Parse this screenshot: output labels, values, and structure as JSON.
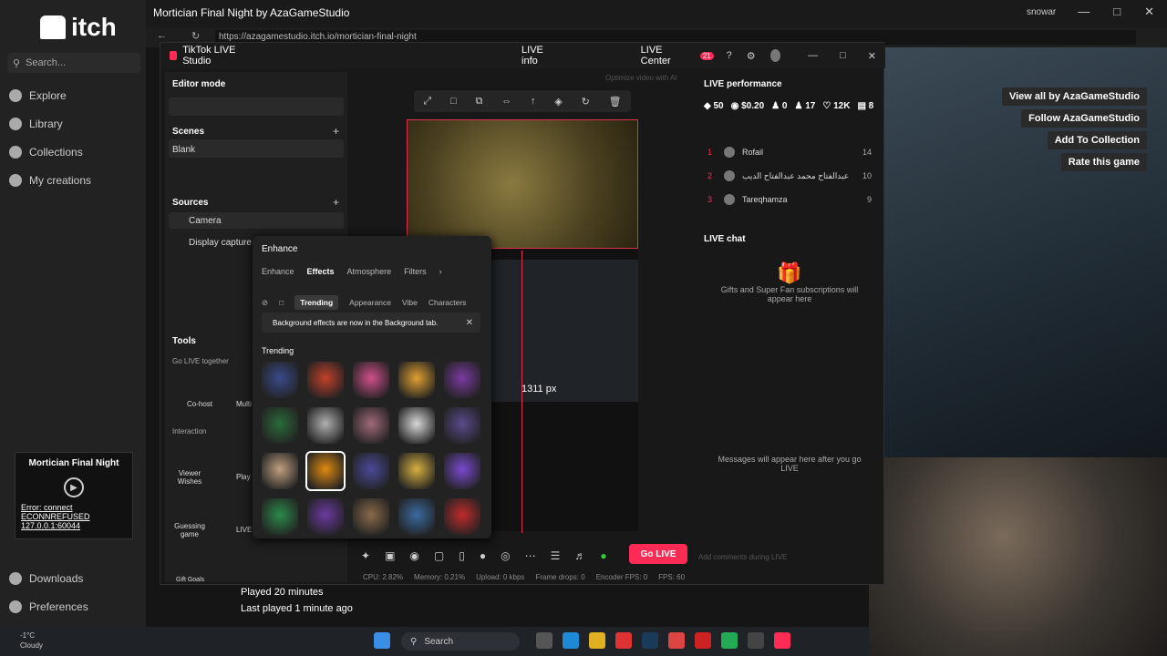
{
  "itch": {
    "logo": "itch",
    "search_placeholder": "Search...",
    "nav": [
      "Explore",
      "Library",
      "Collections",
      "My creations"
    ],
    "bottom_nav": [
      "Downloads",
      "Preferences"
    ],
    "game_card": {
      "title": "Mortician Final Night",
      "error_1": "Error: connect",
      "error_2": "ECONNREFUSED",
      "error_3": "127.0.0.1:60044"
    }
  },
  "window": {
    "title": "Mortician Final Night by AzaGameStudio",
    "user": "snowar",
    "url": "https://azagamestudio.itch.io/mortician-final-night"
  },
  "game_page": {
    "buttons": [
      "View all by AzaGameStudio",
      "Follow AzaGameStudio",
      "Add To Collection",
      "Rate this game"
    ],
    "played": "Played 20 minutes",
    "last_played": "Last played 1 minute ago"
  },
  "tiktok": {
    "app_title": "TikTok LIVE Studio",
    "live_info": "LIVE info",
    "live_center": "LIVE Center",
    "notif_count": "21",
    "editor_mode": "Editor mode",
    "scenes_label": "Scenes",
    "scene_blank": "Blank",
    "sources_label": "Sources",
    "source_camera": "Camera",
    "source_display": "Display capture",
    "tools_label": "Tools",
    "go_live_together": "Go LIVE together",
    "cohost": "Co-host",
    "multi": "Multi",
    "interaction": "Interaction",
    "viewer_wishes": "Viewer Wishes",
    "play": "Play",
    "guessing_game": "Guessing game",
    "live": "LIVE",
    "gift_goals": "Gift Goals",
    "px_label": "1311 px",
    "go_live_button": "Go LIVE",
    "stats": [
      "CPU: 2.82%",
      "Memory: 0.21%",
      "Upload: 0 kbps",
      "Frame drops: 0",
      "Encoder FPS: 0",
      "FPS: 60"
    ],
    "optimize_hint": "Optimize video with AI",
    "performance": {
      "title": "LIVE performance",
      "stats": [
        "50",
        "$0.20",
        "0",
        "17",
        "12K",
        "8"
      ],
      "leaders": [
        {
          "rank": "1",
          "name": "Rofail",
          "score": "14"
        },
        {
          "rank": "2",
          "name": "عبدالفتاح محمد عبدالفتاح الديب",
          "score": "10"
        },
        {
          "rank": "3",
          "name": "Tareqhamza",
          "score": "9"
        }
      ]
    },
    "chat": {
      "title": "LIVE chat",
      "gifts_placeholder": "Gifts and Super Fan subscriptions will appear here",
      "messages_placeholder": "Messages will appear here after you go LIVE",
      "input_placeholder": "Add comments during LIVE"
    },
    "enhance": {
      "title": "Enhance",
      "tabs": [
        "Enhance",
        "Effects",
        "Atmosphere",
        "Filters"
      ],
      "subtabs": [
        "Trending",
        "Appearance",
        "Vibe",
        "Characters"
      ],
      "notice": "Background effects are now in the Background tab.",
      "trending_label": "Trending",
      "tile_colors": [
        "#3a4a8a",
        "#c2402a",
        "#d0508a",
        "#e0a030",
        "#7a3aa0",
        "#2a6a3a",
        "#b0b0b0",
        "#a06a7a",
        "#d8d8d8",
        "#5a4a8a",
        "#c0a080",
        "#e08a10",
        "#4a4a9a",
        "#d8b040",
        "#7a4ad0",
        "#2a8a4a",
        "#6a3aa0",
        "#8a6a4a",
        "#3a6aa0",
        "#c02a2a"
      ]
    }
  },
  "taskbar": {
    "temp": "-1°C",
    "weather": "Cloudy",
    "search": "Search"
  }
}
